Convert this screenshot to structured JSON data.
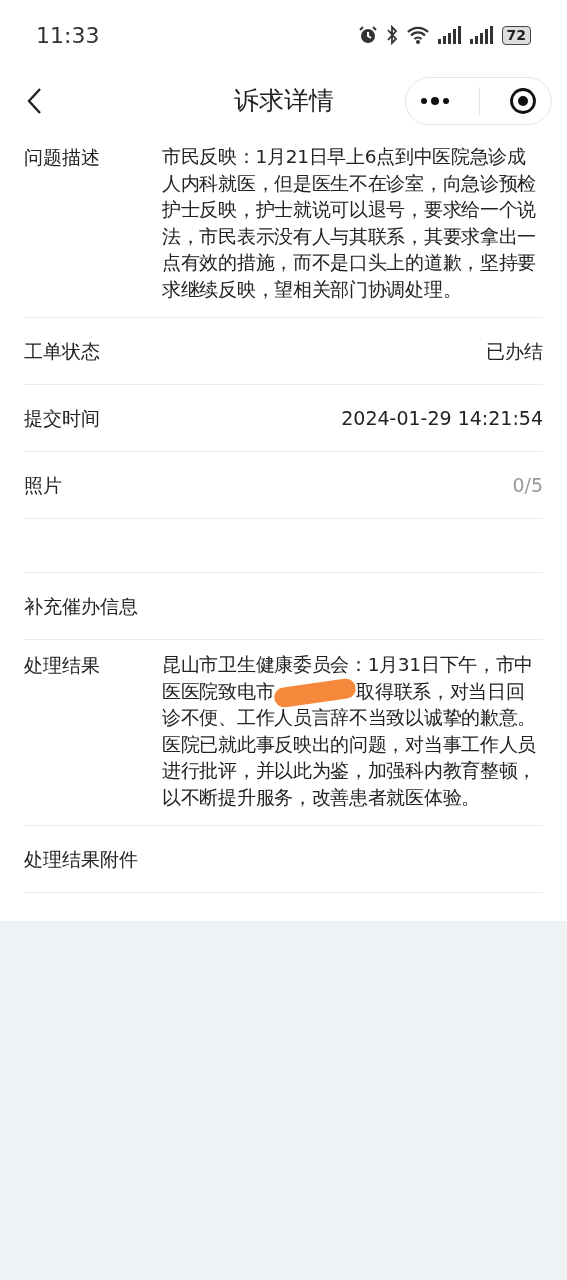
{
  "status_bar": {
    "time": "11:33",
    "battery": "72"
  },
  "header": {
    "title": "诉求详情"
  },
  "fields": [
    {
      "kind": "paragraph",
      "label": "问题描述",
      "value": "市民反映：1月21日早上6点到中医院急诊成人内科就医，但是医生不在诊室，向急诊预检护士反映，护士就说可以退号，要求给一个说法，市民表示没有人与其联系，其要求拿出一点有效的措施，而不是口头上的道歉，坚持要求继续反映，望相关部门协调处理。"
    },
    {
      "kind": "inline",
      "label": "工单状态",
      "value": "已办结"
    },
    {
      "kind": "inline",
      "label": "提交时间",
      "value": "2024-01-29 14:21:54"
    },
    {
      "kind": "count",
      "label": "照片",
      "value": "0/5"
    },
    {
      "kind": "blank"
    },
    {
      "kind": "inline",
      "label": "补充催办信息"
    },
    {
      "kind": "redacted",
      "label": "处理结果",
      "value_parts": [
        "昆山市卫生健康委员会：1月31日下午，市中医医院致电市",
        "取得联系，对当日回诊不便、工作人员言辞不当致以诚挚的歉意。医院已就此事反映出的问题，对当事工作人员进行批评，并以此为鉴，加强科内教育整顿，以不断提升服务，改善患者就医体验。"
      ]
    },
    {
      "kind": "inline",
      "label": "处理结果附件"
    }
  ]
}
